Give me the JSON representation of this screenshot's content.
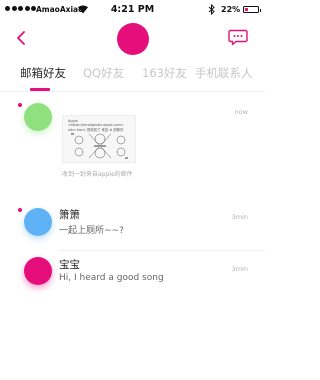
{
  "status_bar": {
    "carrier": "AmaoAxiao",
    "time": "4:21 PM",
    "battery_percent": "22%",
    "battery_level": 0.22
  },
  "header": {
    "back_icon": "chevron-left-icon",
    "message_icon": "chat-bubble-icon",
    "avatar_color": "#e50e7a"
  },
  "tabs": [
    {
      "label": "邮箱好友",
      "active": true
    },
    {
      "label": "QQ好友",
      "active": false
    },
    {
      "label": "163好友",
      "active": false
    },
    {
      "label": "手机联系人",
      "active": false
    }
  ],
  "conversations": [
    {
      "type": "mail",
      "time": "now",
      "avatar_color": "#8fe07f",
      "unread": true,
      "card_header": "Apple <https://mroriginals.apple.com> relm from: 您收到了 来自 # 的邮件",
      "caption": "收到一封来自apple的邮件"
    },
    {
      "type": "chat",
      "name": "箫箫",
      "message": "一起上厕所~~?",
      "time": "3min",
      "avatar_color": "#5fb2f5",
      "unread": true
    },
    {
      "type": "chat",
      "name": "宝宝",
      "message": "Hi,  I heard a good song",
      "time": "3min",
      "avatar_color": "#e50e7a",
      "unread": false
    }
  ]
}
